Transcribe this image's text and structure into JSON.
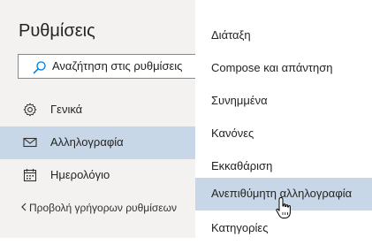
{
  "settings": {
    "title": "Ρυθμίσεις",
    "search": {
      "placeholder": "Αναζήτηση στις ρυθμίσεις",
      "icon": "search-icon"
    },
    "nav": [
      {
        "label": "Γενικά",
        "icon": "gear-icon",
        "selected": false
      },
      {
        "label": "Αλληλογραφία",
        "icon": "mail-icon",
        "selected": true
      },
      {
        "label": "Ημερολόγιο",
        "icon": "calendar-icon",
        "selected": false
      }
    ],
    "quick_settings": "Προβολή γρήγορων ρυθμίσεων"
  },
  "mail_menu": {
    "items": [
      {
        "label": "Διάταξη"
      },
      {
        "label": "Compose και απάντηση"
      },
      {
        "label": "Συνημμένα"
      },
      {
        "label": "Κανόνες"
      },
      {
        "label": "Εκκαθάριση"
      },
      {
        "label": "Ανεπιθύμητη αλληλογραφία",
        "hovered": true
      },
      {
        "label": "Κατηγορίες"
      }
    ]
  },
  "colors": {
    "selected_bg": "#c7d7e8",
    "left_pane_bg": "#f3f2f1"
  }
}
